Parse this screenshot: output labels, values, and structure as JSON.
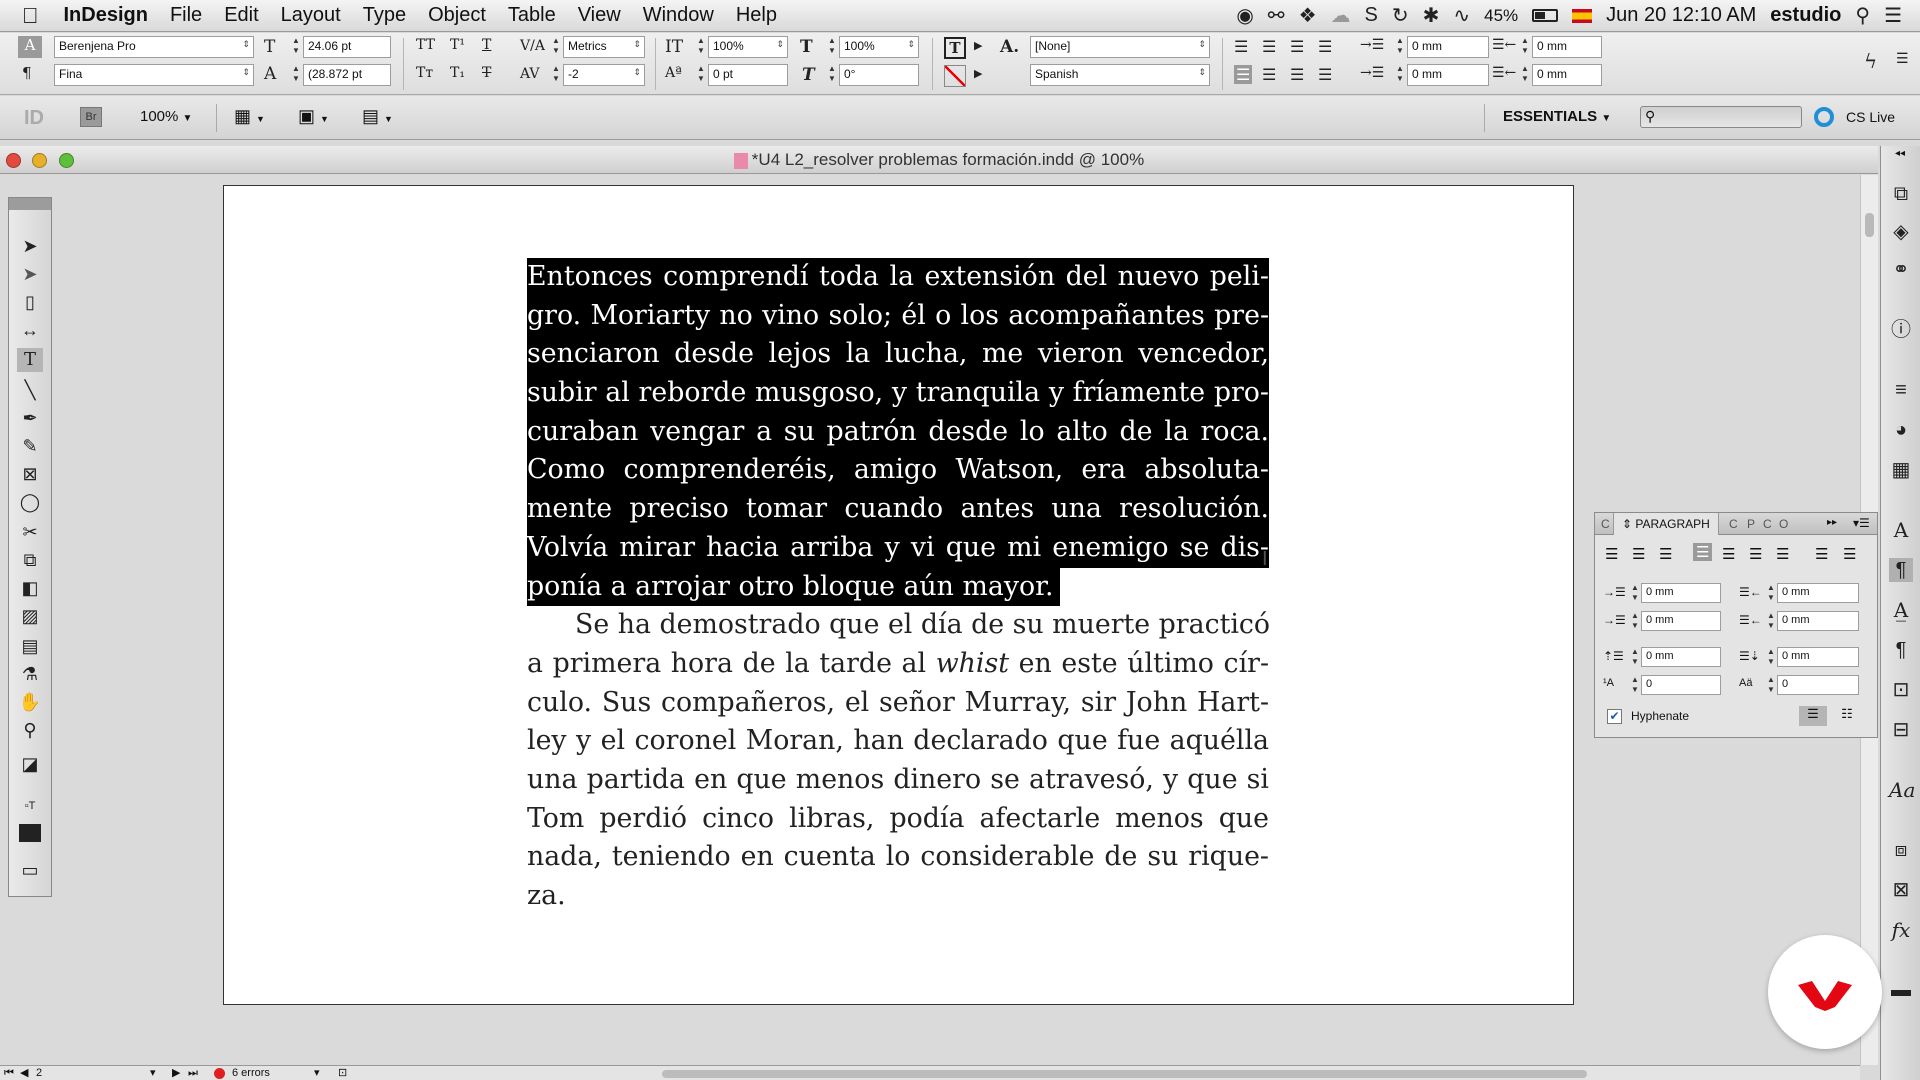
{
  "menubar": {
    "apple": "",
    "app": "InDesign",
    "items": [
      "File",
      "Edit",
      "Layout",
      "Type",
      "Object",
      "Table",
      "View",
      "Window",
      "Help"
    ],
    "battery": "45%",
    "datetime": "Jun 20  12:10 AM",
    "user": "estudio"
  },
  "control": {
    "font_family": "Berenjena Pro",
    "font_style": "Fina",
    "font_size": "24.06 pt",
    "leading": "(28.872 pt",
    "kerning": "Metrics",
    "tracking": "-2",
    "vscale": "100%",
    "hscale": "100%",
    "baseline": "0 pt",
    "skew": "0°",
    "char_style": "[None]",
    "language": "Spanish",
    "left_indent": "0 mm",
    "right_indent": "0 mm",
    "first_indent": "0 mm",
    "last_indent": "0 mm"
  },
  "appbar": {
    "zoom": "100%",
    "br": "Br",
    "workspace": "ESSENTIALS",
    "cslive": "CS Live"
  },
  "document": {
    "title": "*U4 L2_resolver problemas formación.indd @ 100%",
    "selected_lines": [
      "Entonces comprendí toda la extensión del nuevo peli-",
      "gro. Moriarty no vino solo; él o los acompañantes pre-",
      "senciaron desde lejos la lucha, me vieron vencedor,",
      "subir al reborde musgoso, y tranquila y fríamente pro-",
      "curaban vengar a su patrón desde lo alto de la roca.",
      "Como comprenderéis, amigo Watson, era absoluta-",
      "mente preciso tomar cuando antes una resolución.",
      "Volvía mirar hacia arriba y vi que mi enemigo se dis-",
      "ponía a arrojar otro bloque aún mayor."
    ],
    "body_line1": "Se ha demostrado que el día de su muerte practicó",
    "body_line2_a": "a primera hora de la tarde al ",
    "body_line2_em": "whist",
    "body_line2_b": " en este último cír-",
    "body_lines": [
      "culo. Sus compañeros, el señor Murray, sir John Hart-",
      "ley y el coronel Moran, han declarado que fue aquélla",
      "una partida en que menos dinero se atravesó, y que si",
      "Tom perdió cinco libras, podía afectarle menos que",
      "nada, teniendo en cuenta lo considerable de su rique-",
      "za."
    ]
  },
  "paragraph_panel": {
    "title": "PARAGRAPH",
    "tabs": [
      "C",
      "C",
      "P",
      "C",
      "O"
    ],
    "left_indent": "0 mm",
    "right_indent": "0 mm",
    "first_indent": "0 mm",
    "last_indent": "0 mm",
    "space_before": "0 mm",
    "space_after": "0 mm",
    "drop_lines": "0",
    "drop_chars": "0",
    "hyphenate": "Hyphenate"
  },
  "status": {
    "page": "2",
    "errors": "6 errors"
  },
  "colors": {
    "selection": "#000000",
    "error_dot": "#e02020",
    "logo_red": "#e30613"
  }
}
